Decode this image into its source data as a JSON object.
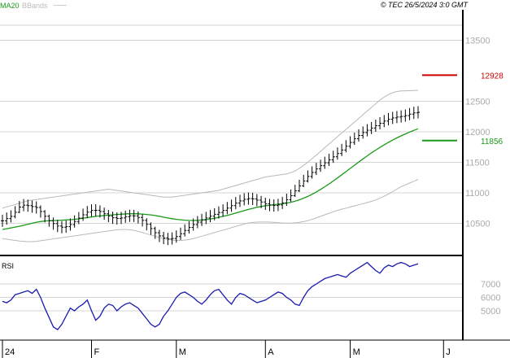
{
  "header": {
    "ma_label": "MA20",
    "bb_label": "BBands",
    "copyright": "© TEC 26/5/2024 3:0 GMT"
  },
  "colors": {
    "background": "#ffffff",
    "grid": "#d4d4d4",
    "axis": "#000000",
    "price_bars": "#000000",
    "ma_line": "#1a9a1a",
    "bbands": "#b8b8b8",
    "rsi_line": "#1a1ab0",
    "resistance": "#cc0000",
    "support": "#1a9a1a",
    "tick_text": "#aaaaaa"
  },
  "chart_data": [
    {
      "type": "ohlc",
      "title": "",
      "indicators": [
        "MA20",
        "BBands"
      ],
      "ylim": [
        10000,
        14000
      ],
      "y_ticks": [
        {
          "value": 10500,
          "label": "10500"
        },
        {
          "value": 11000,
          "label": "11000"
        },
        {
          "value": 11500,
          "label": "11500"
        },
        {
          "value": 12000,
          "label": "12000"
        },
        {
          "value": 12500,
          "label": "12500"
        },
        {
          "value": 13500,
          "label": "13500"
        }
      ],
      "x_ticks": [
        {
          "index": 0,
          "label": "24"
        },
        {
          "index": 21,
          "label": "F"
        },
        {
          "index": 41,
          "label": "M"
        },
        {
          "index": 62,
          "label": "A"
        },
        {
          "index": 82,
          "label": "M"
        },
        {
          "index": 104,
          "label": "J"
        }
      ],
      "grid": true,
      "levels": [
        {
          "name": "resistance",
          "value": 12928,
          "label": "12928",
          "color": "#cc0000"
        },
        {
          "name": "support",
          "value": 11856,
          "label": "11856",
          "color": "#1a9a1a"
        }
      ],
      "close": [
        10542,
        10578,
        10614,
        10682,
        10766,
        10798,
        10790,
        10774,
        10760,
        10694,
        10616,
        10544,
        10496,
        10456,
        10436,
        10446,
        10480,
        10530,
        10586,
        10640,
        10684,
        10712,
        10714,
        10694,
        10658,
        10620,
        10592,
        10580,
        10588,
        10608,
        10624,
        10622,
        10596,
        10548,
        10484,
        10414,
        10346,
        10294,
        10260,
        10244,
        10252,
        10284,
        10330,
        10384,
        10434,
        10480,
        10520,
        10556,
        10588,
        10618,
        10648,
        10678,
        10712,
        10750,
        10790,
        10832,
        10868,
        10894,
        10906,
        10900,
        10880,
        10850,
        10820,
        10800,
        10792,
        10802,
        10834,
        10886,
        10954,
        11032,
        11114,
        11194,
        11268,
        11334,
        11392,
        11444,
        11492,
        11540,
        11590,
        11644,
        11702,
        11764,
        11826,
        11886,
        11940,
        11988,
        12026,
        12062,
        12100,
        12140,
        12176,
        12206,
        12228,
        12242,
        12252,
        12266,
        12290,
        12310,
        12320
      ],
      "high": [
        10642,
        10678,
        10714,
        10782,
        10866,
        10898,
        10890,
        10874,
        10860,
        10794,
        10716,
        10644,
        10596,
        10556,
        10536,
        10546,
        10580,
        10630,
        10686,
        10740,
        10784,
        10812,
        10814,
        10794,
        10758,
        10720,
        10692,
        10680,
        10688,
        10708,
        10724,
        10722,
        10696,
        10648,
        10584,
        10514,
        10446,
        10394,
        10360,
        10344,
        10352,
        10384,
        10430,
        10484,
        10534,
        10580,
        10620,
        10656,
        10688,
        10718,
        10748,
        10778,
        10812,
        10850,
        10890,
        10932,
        10968,
        10994,
        11006,
        11000,
        10980,
        10950,
        10920,
        10900,
        10892,
        10902,
        10934,
        10986,
        11054,
        11132,
        11214,
        11294,
        11368,
        11434,
        11492,
        11544,
        11592,
        11640,
        11690,
        11744,
        11802,
        11864,
        11926,
        11986,
        12040,
        12088,
        12126,
        12162,
        12200,
        12240,
        12276,
        12306,
        12328,
        12342,
        12352,
        12366,
        12390,
        12410,
        12420
      ],
      "low": [
        10442,
        10478,
        10514,
        10582,
        10666,
        10698,
        10690,
        10674,
        10660,
        10594,
        10516,
        10444,
        10396,
        10356,
        10336,
        10346,
        10380,
        10430,
        10486,
        10540,
        10584,
        10612,
        10614,
        10594,
        10558,
        10520,
        10492,
        10480,
        10488,
        10508,
        10524,
        10522,
        10496,
        10448,
        10384,
        10314,
        10246,
        10194,
        10160,
        10144,
        10152,
        10184,
        10230,
        10284,
        10334,
        10380,
        10420,
        10456,
        10488,
        10518,
        10548,
        10578,
        10612,
        10650,
        10690,
        10732,
        10768,
        10794,
        10806,
        10800,
        10780,
        10750,
        10720,
        10700,
        10692,
        10702,
        10734,
        10786,
        10854,
        10932,
        11014,
        11094,
        11168,
        11234,
        11292,
        11344,
        11392,
        11440,
        11490,
        11544,
        11602,
        11664,
        11726,
        11786,
        11840,
        11888,
        11926,
        11962,
        12000,
        12040,
        12076,
        12106,
        12128,
        12142,
        12152,
        12166,
        12190,
        12210,
        12220
      ],
      "ma20": [
        10400,
        10412,
        10425,
        10438,
        10452,
        10468,
        10485,
        10502,
        10518,
        10530,
        10538,
        10542,
        10545,
        10548,
        10552,
        10556,
        10560,
        10566,
        10574,
        10584,
        10594,
        10604,
        10614,
        10622,
        10628,
        10634,
        10640,
        10646,
        10650,
        10654,
        10657,
        10658,
        10656,
        10652,
        10646,
        10638,
        10628,
        10616,
        10602,
        10588,
        10576,
        10566,
        10558,
        10552,
        10548,
        10547,
        10549,
        10554,
        10562,
        10572,
        10584,
        10598,
        10614,
        10630,
        10648,
        10668,
        10688,
        10708,
        10728,
        10746,
        10762,
        10776,
        10788,
        10798,
        10806,
        10814,
        10822,
        10832,
        10846,
        10864,
        10886,
        10912,
        10942,
        10976,
        11014,
        11056,
        11100,
        11146,
        11194,
        11244,
        11296,
        11348,
        11400,
        11452,
        11504,
        11556,
        11606,
        11654,
        11700,
        11744,
        11786,
        11826,
        11864,
        11900,
        11934,
        11966,
        11996,
        12024,
        12050
      ],
      "bb_upper": [
        10750,
        10770,
        10790,
        10810,
        10830,
        10850,
        10870,
        10880,
        10890,
        10900,
        10910,
        10920,
        10930,
        10940,
        10950,
        10960,
        10970,
        10980,
        10990,
        11000,
        11010,
        11020,
        11030,
        11040,
        11050,
        11060,
        11050,
        11040,
        11030,
        11020,
        11010,
        11000,
        10990,
        10980,
        10970,
        10960,
        10950,
        10940,
        10930,
        10930,
        10930,
        10940,
        10950,
        10960,
        10970,
        10980,
        10990,
        11000,
        11010,
        11020,
        11030,
        11040,
        11060,
        11080,
        11100,
        11120,
        11140,
        11160,
        11180,
        11200,
        11220,
        11240,
        11260,
        11270,
        11280,
        11290,
        11300,
        11310,
        11330,
        11360,
        11400,
        11450,
        11500,
        11560,
        11620,
        11680,
        11740,
        11800,
        11860,
        11920,
        11980,
        12040,
        12100,
        12160,
        12220,
        12280,
        12340,
        12400,
        12460,
        12520,
        12570,
        12610,
        12640,
        12660,
        12670,
        12672,
        12674,
        12676,
        12680
      ],
      "bb_lower": [
        10250,
        10240,
        10230,
        10220,
        10210,
        10205,
        10200,
        10200,
        10205,
        10215,
        10225,
        10235,
        10245,
        10255,
        10265,
        10275,
        10285,
        10295,
        10305,
        10315,
        10325,
        10335,
        10345,
        10355,
        10365,
        10375,
        10385,
        10395,
        10400,
        10400,
        10395,
        10385,
        10370,
        10350,
        10330,
        10310,
        10290,
        10270,
        10250,
        10235,
        10225,
        10220,
        10220,
        10225,
        10235,
        10250,
        10270,
        10290,
        10310,
        10330,
        10350,
        10370,
        10390,
        10410,
        10430,
        10450,
        10470,
        10490,
        10505,
        10515,
        10520,
        10522,
        10522,
        10520,
        10516,
        10510,
        10506,
        10504,
        10504,
        10508,
        10516,
        10528,
        10544,
        10564,
        10588,
        10614,
        10640,
        10666,
        10690,
        10712,
        10732,
        10750,
        10768,
        10786,
        10804,
        10822,
        10840,
        10860,
        10884,
        10912,
        10944,
        10980,
        11020,
        11060,
        11100,
        11130,
        11160,
        11190,
        11220
      ]
    },
    {
      "type": "line",
      "title": "RSI",
      "ylim": [
        30,
        90
      ],
      "y_ticks": [
        {
          "value": 50,
          "label": "5000"
        },
        {
          "value": 60,
          "label": "6000"
        },
        {
          "value": 70,
          "label": "7000"
        }
      ],
      "grid": true,
      "series": [
        {
          "name": "RSI",
          "values": [
            57,
            56,
            58,
            62,
            63,
            64,
            65,
            63,
            66,
            60,
            52,
            45,
            38,
            36,
            40,
            46,
            52,
            50,
            53,
            55,
            58,
            50,
            43,
            46,
            52,
            55,
            54,
            50,
            53,
            55,
            56,
            54,
            52,
            48,
            44,
            40,
            38,
            40,
            46,
            50,
            55,
            60,
            63,
            64,
            62,
            60,
            57,
            55,
            58,
            62,
            65,
            66,
            62,
            58,
            55,
            60,
            63,
            62,
            60,
            58,
            56,
            57,
            58,
            60,
            62,
            64,
            63,
            60,
            58,
            55,
            54,
            60,
            65,
            68,
            70,
            72,
            74,
            75,
            76,
            77,
            76,
            75,
            78,
            80,
            82,
            84,
            86,
            83,
            80,
            78,
            82,
            84,
            83,
            85,
            86,
            85,
            83,
            84,
            85
          ]
        }
      ]
    }
  ]
}
